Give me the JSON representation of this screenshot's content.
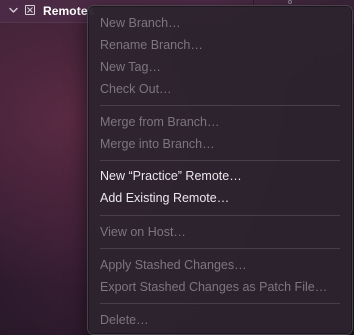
{
  "sidebar": {
    "section_label": "Remotes"
  },
  "menu": {
    "items": [
      {
        "label": "New Branch…",
        "enabled": false
      },
      {
        "label": "Rename Branch…",
        "enabled": false
      },
      {
        "label": "New Tag…",
        "enabled": false
      },
      {
        "label": "Check Out…",
        "enabled": false
      },
      {
        "label": "Merge from Branch…",
        "enabled": false
      },
      {
        "label": "Merge into Branch…",
        "enabled": false
      },
      {
        "label": "New “Practice” Remote…",
        "enabled": true
      },
      {
        "label": "Add Existing Remote…",
        "enabled": true
      },
      {
        "label": "View on Host…",
        "enabled": false
      },
      {
        "label": "Apply Stashed Changes…",
        "enabled": false
      },
      {
        "label": "Export Stashed Changes as Patch File…",
        "enabled": false
      },
      {
        "label": "Delete…",
        "enabled": false
      }
    ]
  },
  "colors": {
    "enabled_text": "#ebe7ec",
    "disabled_text": "#7d7580",
    "menu_background": "#2c242e"
  }
}
